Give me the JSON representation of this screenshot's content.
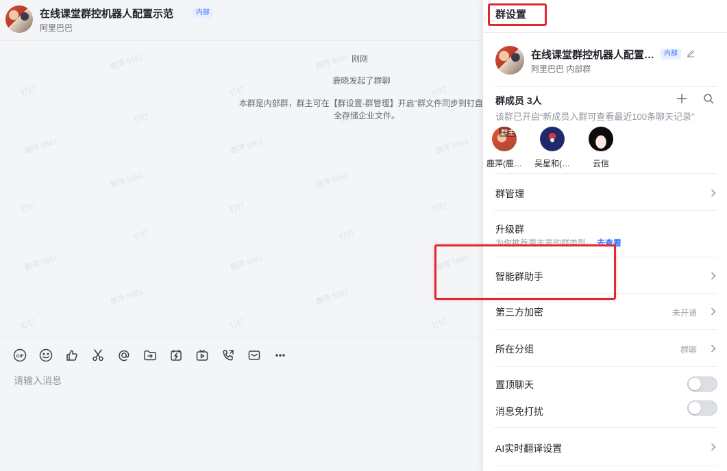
{
  "chat": {
    "group_title": "在线课堂群控机器人配置示范",
    "badge": "内部",
    "org_name": "阿里巴巴",
    "messages": {
      "time": "刚刚",
      "started": "鹿晓发起了群聊",
      "notice": "本群是内部群，群主可在【群设置-群管理】开启\"群文件同步到钉盘\"，\n全存储企业文件。"
    },
    "watermark_texts": [
      "鹿萍 5561",
      "钉钉"
    ],
    "toolbar_icons": [
      "gif-icon",
      "emoji-icon",
      "thumbs-up-icon",
      "scissors-icon",
      "at-icon",
      "forward-icon",
      "ding-icon",
      "live-icon",
      "call-icon",
      "mail-icon",
      "more-icon"
    ],
    "input_placeholder": "请输入消息"
  },
  "settings": {
    "title": "群设置",
    "profile": {
      "name": "在线课堂群控机器人配置示范",
      "badge": "内部",
      "org": "阿里巴巴  内部群"
    },
    "members": {
      "title": "群成员 3人",
      "note": "该群已开启“新成员入群可查看最近100条聊天记录”",
      "owner_tag": "群主",
      "list": [
        {
          "name": "鹿萍(鹿…",
          "avatar": "owner-avatar"
        },
        {
          "name": "吴星和(…",
          "avatar": "rocket-avatar"
        },
        {
          "name": "云信",
          "avatar": "anime-avatar"
        }
      ]
    },
    "rows": {
      "group_manage": "群管理",
      "upgrade": "升级群",
      "upgrade_sub": "为你推荐更丰富的群类型，",
      "upgrade_link": "去查看",
      "assistant": "智能群助手",
      "encryption": "第三方加密",
      "encryption_value": "未开通",
      "group_folder": "所在分组",
      "group_folder_value": "群聊",
      "pin_chat": "置顶聊天",
      "mute": "消息免打扰",
      "ai_translate": "AI实时翻译设置"
    },
    "toggles": {
      "pin_chat": false,
      "mute": false
    }
  },
  "colors": {
    "accent": "#3370ff",
    "highlight": "#e0282e"
  }
}
